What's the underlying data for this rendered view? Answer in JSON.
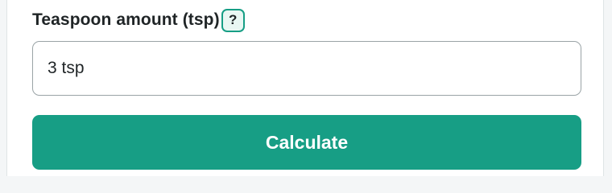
{
  "form": {
    "field_label": "Teaspoon amount (tsp)",
    "help_label": "?",
    "input_value": "3 tsp",
    "submit_label": "Calculate"
  },
  "colors": {
    "accent": "#179e85",
    "help_background": "#e9f7f3",
    "text": "#1f2426",
    "input_border": "#9aa3a6"
  },
  "icons": {
    "help": "question-mark-icon"
  }
}
